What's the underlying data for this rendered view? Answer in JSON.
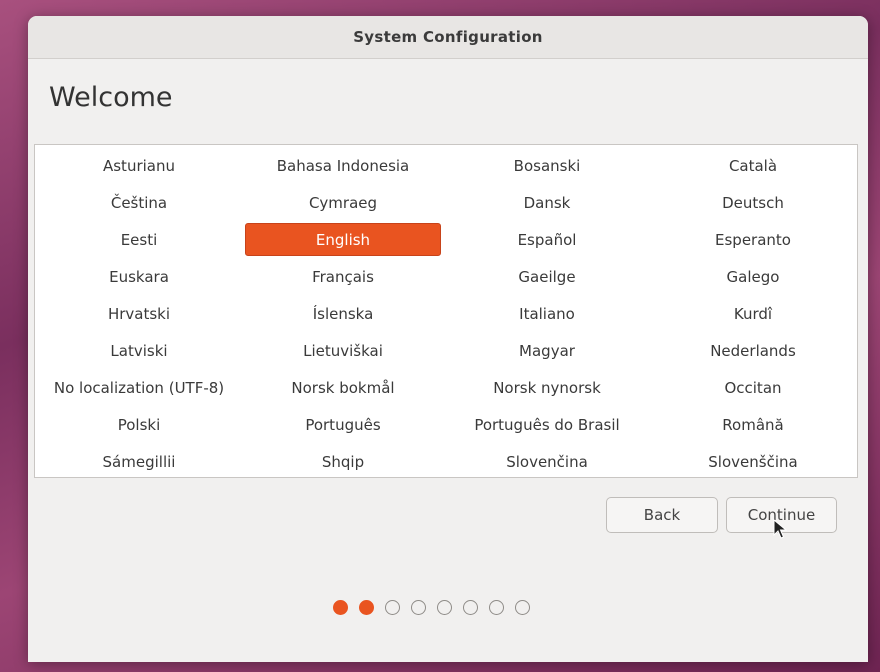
{
  "window": {
    "title": "System Configuration"
  },
  "page": {
    "heading": "Welcome"
  },
  "languages": [
    [
      "Asturianu",
      "Bahasa Indonesia",
      "Bosanski",
      "Català"
    ],
    [
      "Čeština",
      "Cymraeg",
      "Dansk",
      "Deutsch"
    ],
    [
      "Eesti",
      "English",
      "Español",
      "Esperanto"
    ],
    [
      "Euskara",
      "Français",
      "Gaeilge",
      "Galego"
    ],
    [
      "Hrvatski",
      "Íslenska",
      "Italiano",
      "Kurdî"
    ],
    [
      "Latviski",
      "Lietuviškai",
      "Magyar",
      "Nederlands"
    ],
    [
      "No localization (UTF-8)",
      "Norsk bokmål",
      "Norsk nynorsk",
      "Occitan"
    ],
    [
      "Polski",
      "Português",
      "Português do Brasil",
      "Română"
    ],
    [
      "Sámegillii",
      "Shqip",
      "Slovenčina",
      "Slovenščina"
    ]
  ],
  "selected_language": "English",
  "buttons": {
    "back": "Back",
    "continue": "Continue"
  },
  "progress": {
    "current_step": 2,
    "total_steps": 8
  },
  "colors": {
    "accent": "#e95420"
  }
}
